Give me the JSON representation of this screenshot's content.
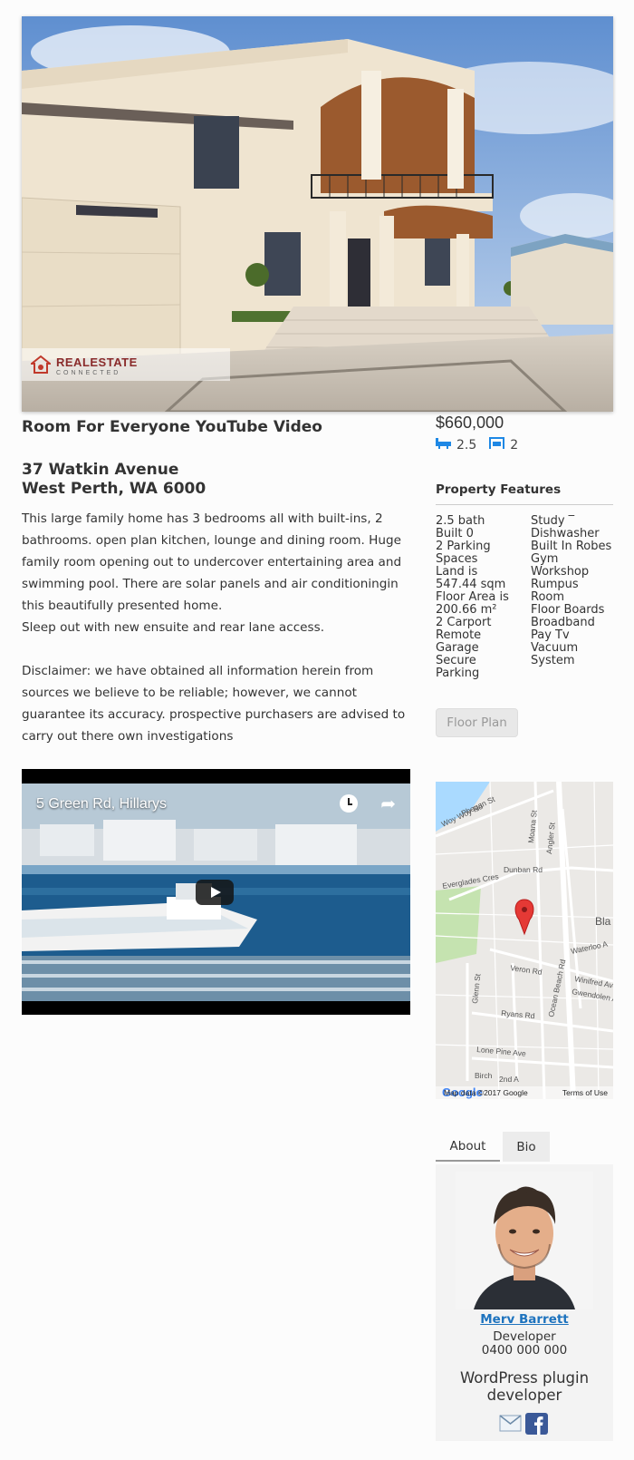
{
  "hero": {
    "logo_main": "REALESTATE",
    "logo_sub": "CONNECTED"
  },
  "listing": {
    "video_title": "Room For Everyone YouTube Video",
    "address_line1": "37 Watkin Avenue",
    "address_line2": "West Perth, WA 6000",
    "description": [
      "This large family home has 3 bedrooms all with built-ins, 2 bathrooms. open plan kitchen, lounge and dining room. Huge family room opening out to undercover entertaining area and swimming pool. There are solar panels and air conditioningin this beautifully presented home.",
      "Sleep out with new ensuite and rear lane access.",
      "",
      "Disclaimer: we have obtained all information herein from sources we believe to be reliable; however, we cannot guarantee its accuracy. prospective purchasers are advised to carry out there own investigations"
    ],
    "price": "$660,000",
    "bathrooms": "2.5",
    "parking": "2"
  },
  "video": {
    "label": "5 Green Rd, Hillarys",
    "icons": [
      "clock-icon",
      "share-icon",
      "play-icon"
    ]
  },
  "features": {
    "heading": "Property Features",
    "col1": [
      "2.5 bath",
      "Built 0",
      "2 Parking",
      "Spaces",
      "Land is",
      "547.44 sqm",
      "Floor Area is",
      "200.66 m²",
      "2 Carport",
      "Remote",
      "Garage",
      "Secure",
      "Parking"
    ],
    "col2": [
      "Study ‾",
      "Dishwasher",
      "Built In Robes",
      "Gym",
      "Workshop",
      "Rumpus",
      "Room",
      "Floor Boards",
      "Broadband",
      "Pay Tv",
      "Vacuum",
      "System"
    ],
    "floor_plan_label": "Floor Plan"
  },
  "map": {
    "streets": [
      "Woy Woy Rd",
      "Phegan St",
      "Moana St",
      "Angler St",
      "Dunban Rd",
      "Everglades Cres",
      "Bla",
      "Waterloo A",
      "Glenn St",
      "Veron Rd",
      "Ocean Beach Rd",
      "Winifred Ave",
      "Gwendolen A",
      "Ryans Rd",
      "Lone Pine Ave",
      "Birch",
      "2nd A"
    ],
    "google": "Google",
    "map_data": "Map data ©2017 Google",
    "terms": "Terms of Use",
    "marker_color": "#e53935"
  },
  "agent": {
    "tabs": [
      "About",
      "Bio"
    ],
    "name": "Merv Barrett",
    "role": "Developer",
    "phone": "0400 000 000",
    "bio": "WordPress plugin developer",
    "icons": [
      "email-icon",
      "facebook-icon"
    ]
  },
  "colors": {
    "link": "#1e73be",
    "icon_blue": "#1e88e5"
  }
}
